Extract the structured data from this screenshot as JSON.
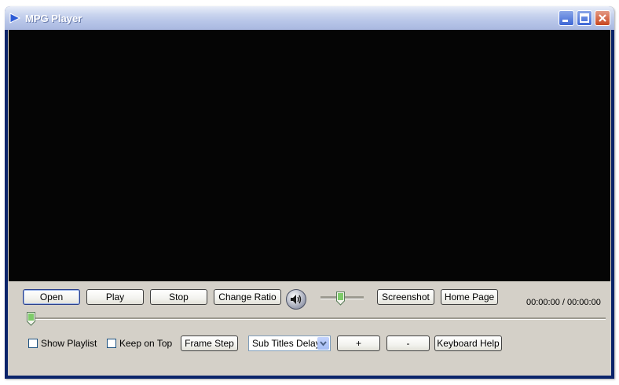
{
  "window": {
    "title": "MPG Player",
    "icon": "play-triangle-icon",
    "controls": [
      "minimize-icon",
      "maximize-icon",
      "close-icon"
    ]
  },
  "controls_row1": {
    "open": "Open",
    "play": "Play",
    "stop": "Stop",
    "change_ratio": "Change Ratio",
    "volume_icon": "speaker-icon",
    "screenshot": "Screenshot",
    "home_page": "Home Page",
    "time": "00:00:00 / 00:00:00"
  },
  "volume": {
    "level": 0.45
  },
  "seek": {
    "position": 0
  },
  "controls_row2": {
    "show_playlist": {
      "label": "Show Playlist",
      "checked": false
    },
    "keep_on_top": {
      "label": "Keep on Top",
      "checked": false
    },
    "frame_step": "Frame Step",
    "subtitle_select": "Sub Titles Delay",
    "plus": "+",
    "minus": "-",
    "keyboard_help": "Keyboard Help"
  },
  "colors": {
    "titlebar": "#b7c5e8",
    "video": "#050505",
    "panel": "#d4d0c8"
  }
}
